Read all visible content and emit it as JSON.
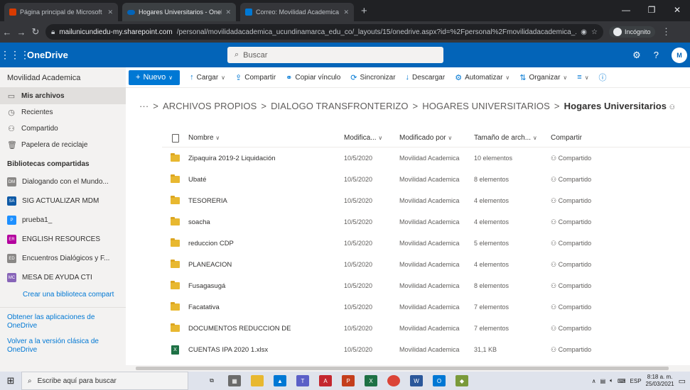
{
  "browser": {
    "tabs": [
      {
        "title": "Página principal de Microsoft Of",
        "icon_color": "#d83b01"
      },
      {
        "title": "Hogares Universitarios - OneDriv",
        "icon_color": "#0364b8"
      },
      {
        "title": "Correo: Movilidad Academica - C",
        "icon_color": "#0078d4"
      }
    ],
    "new_tab": "+",
    "url_host": "mailunicundiedu-my.sharepoint.com",
    "url_path": "/personal/movilidadacademica_ucundinamarca_edu_co/_layouts/15/onedrive.aspx?id=%2Fpersonal%2Fmovilidadacademica_...",
    "incognito_label": "Incógnito"
  },
  "suite": {
    "app_name": "OneDrive",
    "search_placeholder": "Buscar",
    "avatar_initials": "M",
    "help": "?"
  },
  "sidebar": {
    "user": "Movilidad Academica",
    "nav": [
      {
        "label": "Mis archivos",
        "icon": "folder-icon"
      },
      {
        "label": "Recientes",
        "icon": "clock-icon"
      },
      {
        "label": "Compartido",
        "icon": "share-icon"
      },
      {
        "label": "Papelera de reciclaje",
        "icon": "trash-icon"
      }
    ],
    "libraries_heading": "Bibliotecas compartidas",
    "libraries": [
      {
        "label": "Dialogando con el Mundo...",
        "color": "#8a8886",
        "abbr": "DM"
      },
      {
        "label": "SIG ACTUALIZAR MDM",
        "color": "#0f5aa6",
        "abbr": "SA"
      },
      {
        "label": "prueba1_",
        "color": "#1e90ff",
        "abbr": "P"
      },
      {
        "label": "ENGLISH RESOURCES",
        "color": "#b4009e",
        "abbr": "ER"
      },
      {
        "label": "Encuentros Dialógicos y F...",
        "color": "#8a8886",
        "abbr": "ED"
      },
      {
        "label": "MESA DE AYUDA CTI",
        "color": "#8764b8",
        "abbr": "MC"
      }
    ],
    "create_library": "Crear una biblioteca compart",
    "get_apps": "Obtener las aplicaciones de OneDrive",
    "classic": "Volver a la versión clásica de OneDrive"
  },
  "commands": {
    "new": "Nuevo",
    "upload": "Cargar",
    "share": "Compartir",
    "copy_link": "Copiar vínculo",
    "sync": "Sincronizar",
    "download": "Descargar",
    "automate": "Automatizar",
    "organize": "Organizar"
  },
  "breadcrumb": {
    "ellipsis": "···",
    "items": [
      "ARCHIVOS PROPIOS",
      "DIALOGO TRANSFRONTERIZO",
      "HOGARES UNIVERSITARIOS"
    ],
    "current": "Hogares Universitarios"
  },
  "table": {
    "headers": {
      "name": "Nombre",
      "modified": "Modifica...",
      "modified_by": "Modificado por",
      "size": "Tamaño de arch...",
      "sharing": "Compartir"
    },
    "rows": [
      {
        "type": "folder",
        "name": "Zipaquira 2019-2 Liquidación",
        "modified": "10/5/2020",
        "by": "Movilidad Academica",
        "size": "10 elementos",
        "sharing": "Compartido"
      },
      {
        "type": "folder",
        "name": "Ubaté",
        "modified": "10/5/2020",
        "by": "Movilidad Academica",
        "size": "8 elementos",
        "sharing": "Compartido"
      },
      {
        "type": "folder",
        "name": "TESORERIA",
        "modified": "10/5/2020",
        "by": "Movilidad Academica",
        "size": "4 elementos",
        "sharing": "Compartido"
      },
      {
        "type": "folder",
        "name": "soacha",
        "modified": "10/5/2020",
        "by": "Movilidad Academica",
        "size": "4 elementos",
        "sharing": "Compartido"
      },
      {
        "type": "folder",
        "name": "reduccion CDP",
        "modified": "10/5/2020",
        "by": "Movilidad Academica",
        "size": "5 elementos",
        "sharing": "Compartido"
      },
      {
        "type": "folder",
        "name": "PLANEACION",
        "modified": "10/5/2020",
        "by": "Movilidad Academica",
        "size": "4 elementos",
        "sharing": "Compartido"
      },
      {
        "type": "folder",
        "name": "Fusagasugá",
        "modified": "10/5/2020",
        "by": "Movilidad Academica",
        "size": "8 elementos",
        "sharing": "Compartido"
      },
      {
        "type": "folder",
        "name": "Facatativa",
        "modified": "10/5/2020",
        "by": "Movilidad Academica",
        "size": "7 elementos",
        "sharing": "Compartido"
      },
      {
        "type": "folder",
        "name": "DOCUMENTOS REDUCCION DE",
        "modified": "10/5/2020",
        "by": "Movilidad Academica",
        "size": "7 elementos",
        "sharing": "Compartido"
      },
      {
        "type": "xlsx",
        "name": "CUENTAS IPA 2020 1.xlsx",
        "modified": "10/5/2020",
        "by": "Movilidad Academica",
        "size": "31,1 KB",
        "sharing": "Compartido"
      }
    ]
  },
  "taskbar": {
    "search_placeholder": "Escribe aquí para buscar",
    "lang": "ESP",
    "time": "8:18 a. m.",
    "date": "25/03/2021"
  },
  "colors": {
    "brand": "#0364b8",
    "accent": "#0078d4",
    "folder": "#e8b830"
  }
}
